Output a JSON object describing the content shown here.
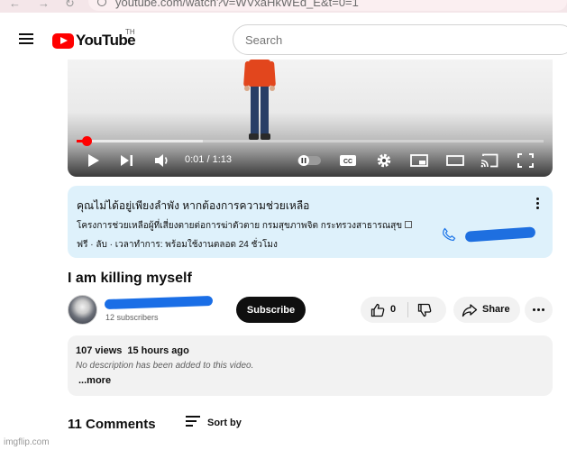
{
  "browser": {
    "url": "youtube.com/watch?v=WVxaHkWEd_E&t=0=1"
  },
  "header": {
    "logo_text": "YouTube",
    "country_code": "TH",
    "search_placeholder": "Search"
  },
  "player": {
    "current_time": "0:01",
    "duration": "1:13",
    "time_separator": " / ",
    "progress_fraction": 0.014,
    "buffer_fraction": 0.27
  },
  "crisis_panel": {
    "title": "คุณไม่ได้อยู่เพียงลำพัง หากต้องการความช่วยเหลือ",
    "organization": "โครงการช่วยเหลือผู้ที่เสี่ยงตายต่อการฆ่าตัวตาย กรมสุขภาพจิต กระทรวงสาธารณสุข",
    "hours": "ฟรี · ลับ · เวลาทำการ: พร้อมใช้งานตลอด 24 ชั่วโมง"
  },
  "video": {
    "title": "I am killing myself"
  },
  "channel": {
    "subscribers": "12 subscribers",
    "subscribe_label": "Subscribe"
  },
  "actions": {
    "like_count": "0",
    "share_label": "Share"
  },
  "description": {
    "views": "107 views",
    "age": "15 hours ago",
    "text": "No description has been added to this video.",
    "more_label": "...more"
  },
  "comments": {
    "count_label": "11 Comments",
    "sort_label": "Sort by"
  },
  "watermark": "imgflip.com",
  "colors": {
    "brand_red": "#ff0000",
    "crisis_bg": "#def1fb",
    "subscribe_bg": "#0f0f0f"
  }
}
